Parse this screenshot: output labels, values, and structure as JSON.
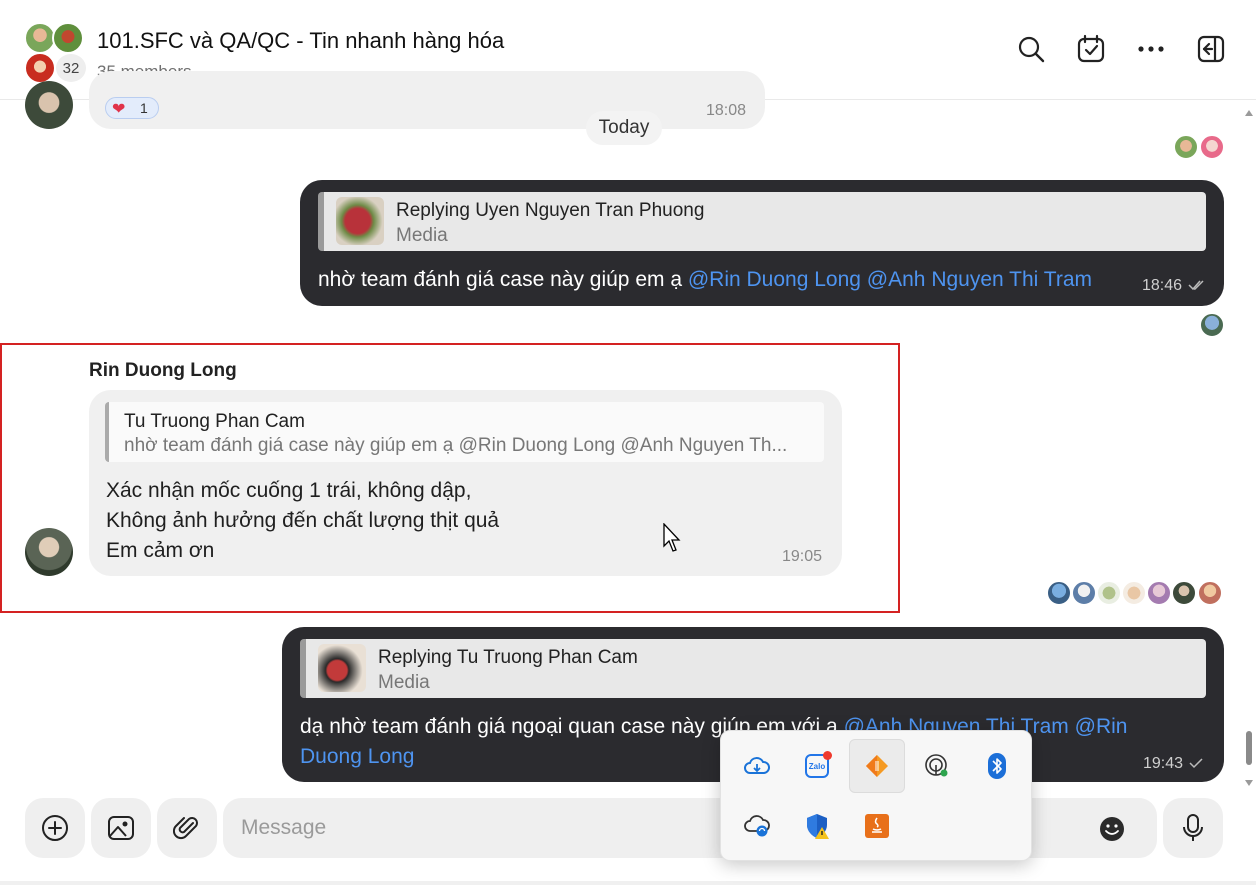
{
  "header": {
    "title": "101.SFC và QA/QC - Tin nhanh hàng hóa",
    "members": "35 members",
    "avatar_count": "32",
    "icons": [
      "search-icon",
      "calendar-check-icon",
      "more-icon",
      "sidebar-toggle-icon"
    ]
  },
  "chat": {
    "prev_message_time": "18:08",
    "reaction_count": "1",
    "date_separator": "Today",
    "messages": [
      {
        "direction": "out",
        "reply_label": "Replying Uyen Nguyen Tran Phuong",
        "reply_type": "Media",
        "text": "nhờ team đánh giá case này giúp em ạ ",
        "mention1": "@Rin Duong Long",
        "mention2": "@Anh Nguyen Thi Tram",
        "time": "18:46"
      },
      {
        "direction": "in",
        "sender": "Rin Duong Long",
        "quote_author": "Tu Truong Phan Cam",
        "quote_text": "nhờ team đánh giá case này giúp em ạ @Rin Duong Long @Anh Nguyen Th...",
        "lines": [
          "Xác nhận mốc cuống 1 trái, không dập,",
          "Không ảnh hưởng đến chất lượng thịt quả",
          "Em cảm ơn"
        ],
        "time": "19:05"
      },
      {
        "direction": "out",
        "reply_label": "Replying Tu Truong Phan Cam",
        "reply_type": "Media",
        "text": "dạ nhờ team đánh giá ngoại quan case này giúp em với ạ ",
        "mention1": "@Anh Nguyen Thi Tram",
        "mention2": "@Rin Duong Long",
        "time": "19:43"
      }
    ]
  },
  "composer": {
    "placeholder": "Message",
    "icons": [
      "add-icon",
      "image-icon",
      "attach-icon",
      "emoji-icon",
      "microphone-icon"
    ]
  },
  "tray": {
    "icons": [
      "onedrive-icon",
      "zalo-icon",
      "app-icon",
      "hotspot-icon",
      "bluetooth-icon",
      "onedrive-sync-icon",
      "windows-security-icon",
      "java-icon"
    ]
  },
  "colors": {
    "mention": "#4e94f0",
    "outgoing_bubble": "#2b2b2f",
    "incoming_bubble": "#f0f0f0",
    "highlight_box": "#d42222"
  }
}
